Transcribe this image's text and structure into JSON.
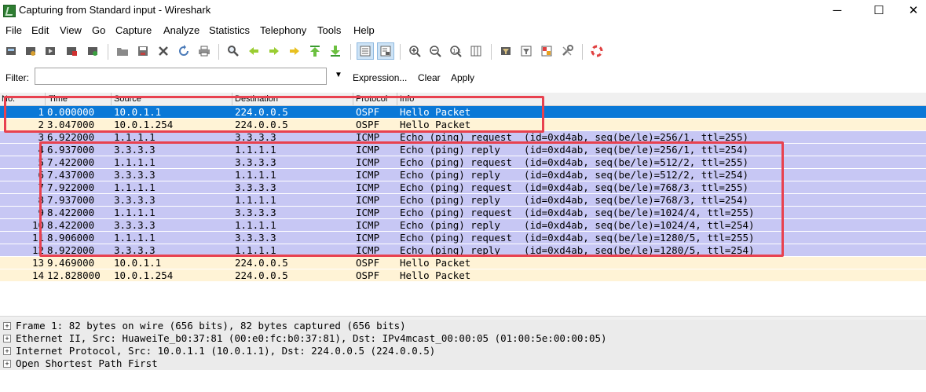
{
  "window": {
    "title": "Capturing from Standard input - Wireshark",
    "minimize": "─",
    "maximize": "☐",
    "close": "✕"
  },
  "menu": [
    "File",
    "Edit",
    "View",
    "Go",
    "Capture",
    "Analyze",
    "Statistics",
    "Telephony",
    "Tools",
    "Help"
  ],
  "toolbar_icons": [
    "interface-list-icon",
    "capture-options-icon",
    "start-capture-icon",
    "stop-capture-icon",
    "restart-capture-icon",
    "open-file-icon",
    "save-file-icon",
    "close-file-icon",
    "reload-icon",
    "print-icon",
    "find-packet-icon",
    "go-back-icon",
    "go-forward-icon",
    "go-to-packet-icon",
    "go-first-icon",
    "go-last-icon",
    "colorize-icon",
    "auto-scroll-icon",
    "zoom-in-icon",
    "zoom-out-icon",
    "normal-size-icon",
    "resize-columns-icon",
    "capture-filters-icon",
    "display-filters-icon",
    "coloring-rules-icon",
    "preferences-icon",
    "help-icon"
  ],
  "filter": {
    "label": "Filter:",
    "value": "",
    "expression": "Expression...",
    "clear": "Clear",
    "apply": "Apply"
  },
  "columns": {
    "no": "No.",
    "time": "Time",
    "source": "Source",
    "destination": "Destination",
    "protocol": "Protocol",
    "info": "Info"
  },
  "packets": [
    {
      "no": "1",
      "time": "0.000000",
      "src": "10.0.1.1",
      "dst": "224.0.0.5",
      "proto": "OSPF",
      "info": "Hello Packet"
    },
    {
      "no": "2",
      "time": "3.047000",
      "src": "10.0.1.254",
      "dst": "224.0.0.5",
      "proto": "OSPF",
      "info": "Hello Packet"
    },
    {
      "no": "3",
      "time": "6.922000",
      "src": "1.1.1.1",
      "dst": "3.3.3.3",
      "proto": "ICMP",
      "info": "Echo (ping) request  (id=0xd4ab, seq(be/le)=256/1, ttl=255)"
    },
    {
      "no": "4",
      "time": "6.937000",
      "src": "3.3.3.3",
      "dst": "1.1.1.1",
      "proto": "ICMP",
      "info": "Echo (ping) reply    (id=0xd4ab, seq(be/le)=256/1, ttl=254)"
    },
    {
      "no": "5",
      "time": "7.422000",
      "src": "1.1.1.1",
      "dst": "3.3.3.3",
      "proto": "ICMP",
      "info": "Echo (ping) request  (id=0xd4ab, seq(be/le)=512/2, ttl=255)"
    },
    {
      "no": "6",
      "time": "7.437000",
      "src": "3.3.3.3",
      "dst": "1.1.1.1",
      "proto": "ICMP",
      "info": "Echo (ping) reply    (id=0xd4ab, seq(be/le)=512/2, ttl=254)"
    },
    {
      "no": "7",
      "time": "7.922000",
      "src": "1.1.1.1",
      "dst": "3.3.3.3",
      "proto": "ICMP",
      "info": "Echo (ping) request  (id=0xd4ab, seq(be/le)=768/3, ttl=255)"
    },
    {
      "no": "8",
      "time": "7.937000",
      "src": "3.3.3.3",
      "dst": "1.1.1.1",
      "proto": "ICMP",
      "info": "Echo (ping) reply    (id=0xd4ab, seq(be/le)=768/3, ttl=254)"
    },
    {
      "no": "9",
      "time": "8.422000",
      "src": "1.1.1.1",
      "dst": "3.3.3.3",
      "proto": "ICMP",
      "info": "Echo (ping) request  (id=0xd4ab, seq(be/le)=1024/4, ttl=255)"
    },
    {
      "no": "10",
      "time": "8.422000",
      "src": "3.3.3.3",
      "dst": "1.1.1.1",
      "proto": "ICMP",
      "info": "Echo (ping) reply    (id=0xd4ab, seq(be/le)=1024/4, ttl=254)"
    },
    {
      "no": "11",
      "time": "8.906000",
      "src": "1.1.1.1",
      "dst": "3.3.3.3",
      "proto": "ICMP",
      "info": "Echo (ping) request  (id=0xd4ab, seq(be/le)=1280/5, ttl=255)"
    },
    {
      "no": "12",
      "time": "8.922000",
      "src": "3.3.3.3",
      "dst": "1.1.1.1",
      "proto": "ICMP",
      "info": "Echo (ping) reply    (id=0xd4ab, seq(be/le)=1280/5, ttl=254)"
    },
    {
      "no": "13",
      "time": "9.469000",
      "src": "10.0.1.1",
      "dst": "224.0.0.5",
      "proto": "OSPF",
      "info": "Hello Packet"
    },
    {
      "no": "14",
      "time": "12.828000",
      "src": "10.0.1.254",
      "dst": "224.0.0.5",
      "proto": "OSPF",
      "info": "Hello Packet"
    }
  ],
  "selected_packet": "1",
  "details": [
    {
      "text": "Frame 1: 82 bytes on wire (656 bits), 82 bytes captured (656 bits)"
    },
    {
      "text": "Ethernet II, Src: HuaweiTe_b0:37:81 (00:e0:fc:b0:37:81), Dst: IPv4mcast_00:00:05 (01:00:5e:00:00:05)"
    },
    {
      "text": "Internet Protocol, Src: 10.0.1.1 (10.0.1.1), Dst: 224.0.0.5 (224.0.0.5)"
    },
    {
      "text": "Open Shortest Path First"
    }
  ],
  "expander_symbol": "+",
  "colors": {
    "selected_row": "#0a78d7",
    "ospf_row": "#fff3d6",
    "icmp_row": "#c7c7f4",
    "highlight_box": "#e8414f"
  }
}
